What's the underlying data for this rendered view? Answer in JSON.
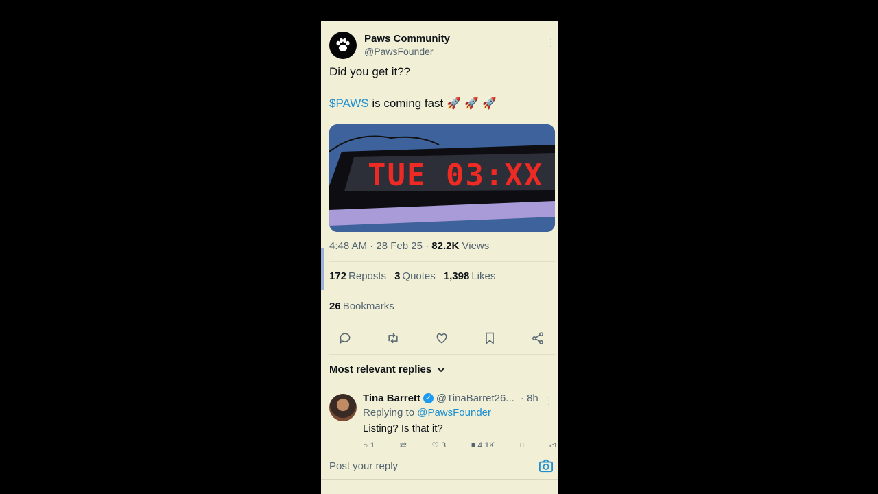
{
  "post": {
    "display_name": "Paws Community",
    "handle": "@PawsFounder",
    "text_line1": "Did you get it??",
    "cashtag": "$PAWS",
    "text_line2_rest": " is coming fast 🚀 🚀 🚀",
    "media_text": "TUE 03:XX",
    "time": "4:48 AM",
    "date": "28 Feb 25",
    "views_count": "82.2K",
    "views_label": "Views"
  },
  "stats": {
    "reposts_count": "172",
    "reposts_label": "Reposts",
    "quotes_count": "3",
    "quotes_label": "Quotes",
    "likes_count": "1,398",
    "likes_label": "Likes",
    "bookmarks_count": "26",
    "bookmarks_label": "Bookmarks"
  },
  "replies": {
    "sort_label": "Most relevant replies",
    "items": [
      {
        "name": "Tina Barrett",
        "handle": "@TinaBarret26...",
        "time": "· 8h",
        "replying_prefix": "Replying to ",
        "replying_to": "@PawsFounder",
        "text": "Listing? Is that it?",
        "reply_count": "1",
        "like_count": "3",
        "view_count": "4.1K"
      }
    ]
  },
  "composer": {
    "placeholder": "Post your reply"
  },
  "colors": {
    "background": "#f1efd5",
    "accent": "#1d8fd1",
    "text": "#0f1419",
    "muted": "#536471"
  },
  "icons": [
    "paw-icon",
    "reply-icon",
    "repost-icon",
    "like-icon",
    "bookmark-icon",
    "share-icon",
    "chevron-down-icon",
    "camera-icon",
    "verified-icon",
    "more-icon"
  ]
}
